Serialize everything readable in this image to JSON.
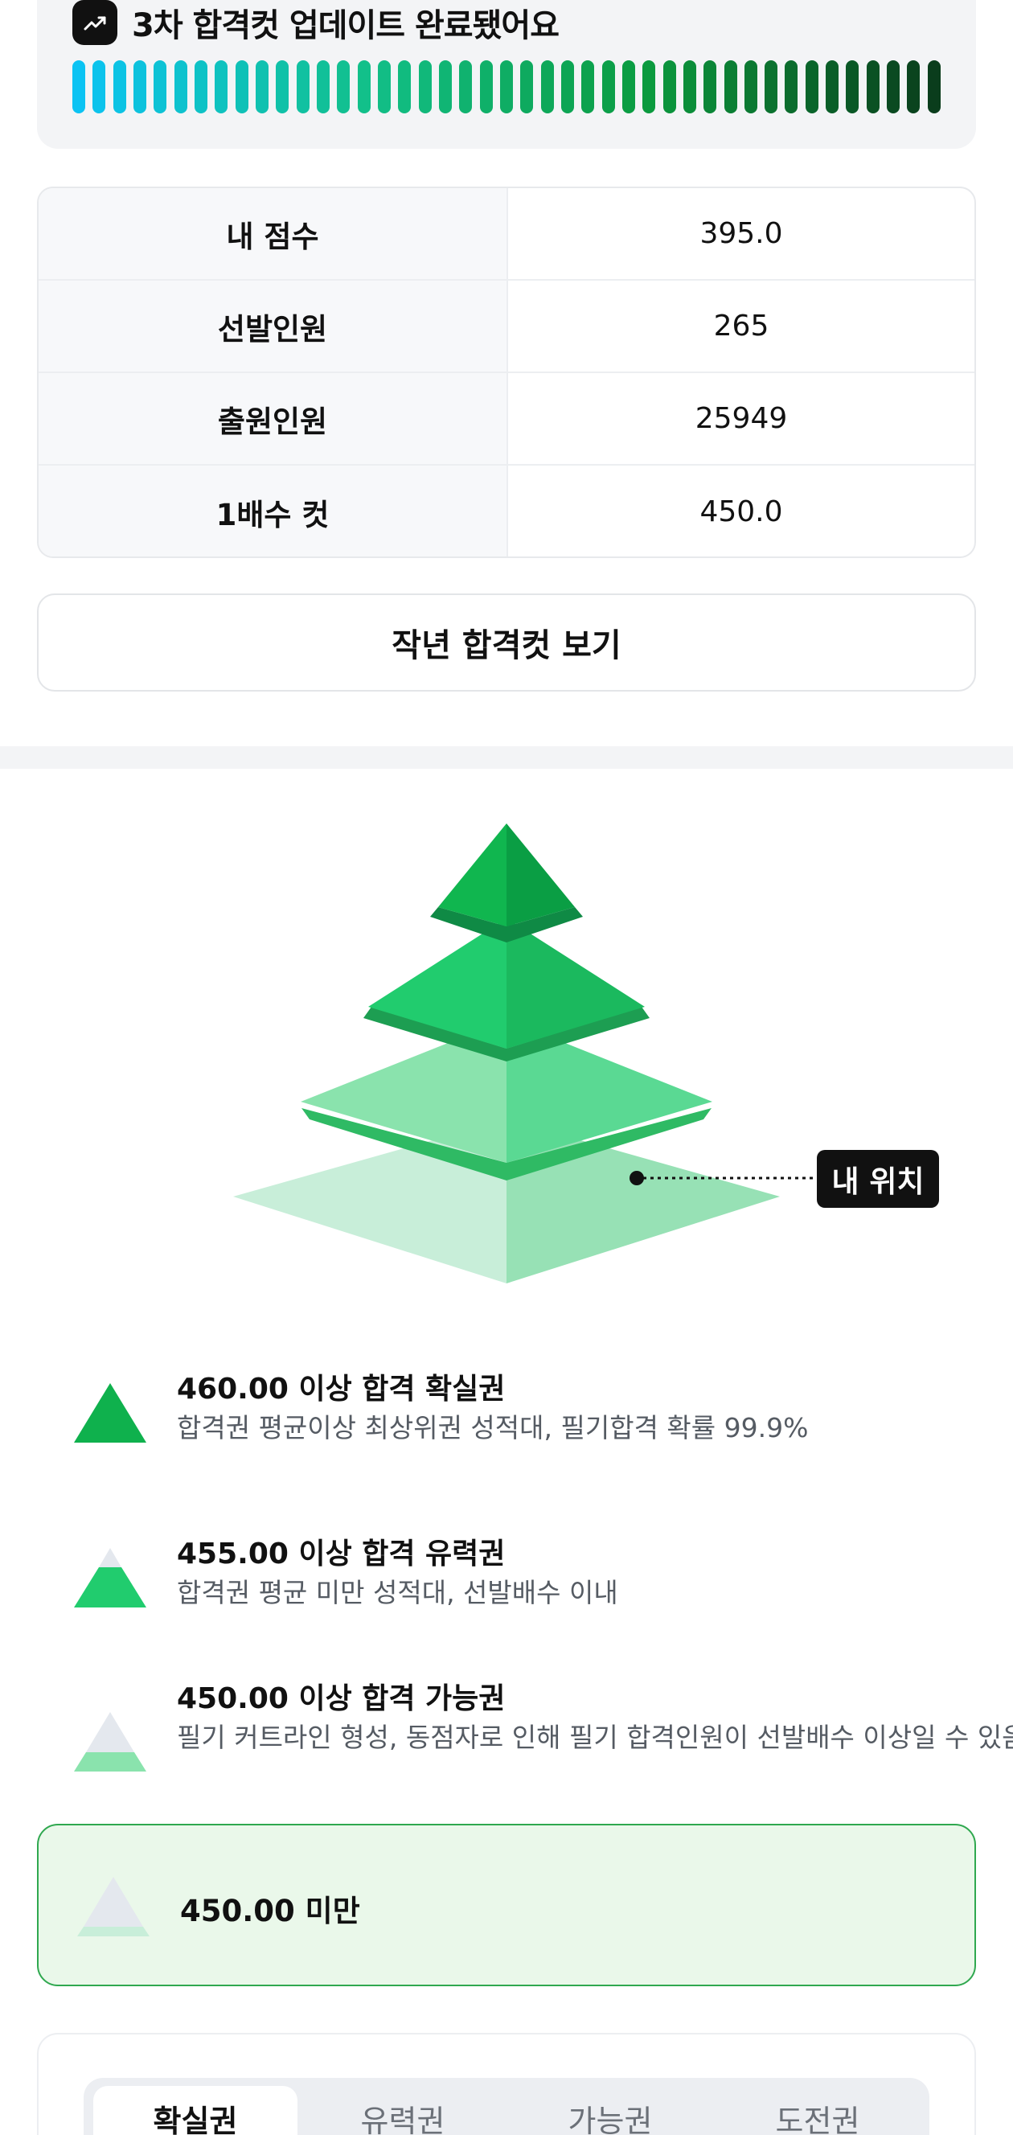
{
  "update_banner": {
    "icon": "trend-up-icon",
    "title": "3차 합격컷 업데이트 완료됐어요",
    "bar_count": 43,
    "gradient_colors": [
      "#0bc3f3",
      "#12c08a",
      "#0b9a3e",
      "#0a3d1c"
    ]
  },
  "stats": [
    {
      "label": "내 점수",
      "value": "395.0"
    },
    {
      "label": "선발인원",
      "value": "265"
    },
    {
      "label": "출원인원",
      "value": "25949"
    },
    {
      "label": "1배수 컷",
      "value": "450.0"
    }
  ],
  "last_year_button": "작년 합격컷 보기",
  "pyramid": {
    "my_position_label": "내 위치",
    "tier_colors": [
      "#0fb14d",
      "#21cc6e",
      "#8ae3ad",
      "#c8eed9"
    ]
  },
  "legend": [
    {
      "title": "460.00 이상 합격 확실권",
      "desc": "합격권 평균이상 최상위권 성적대, 필기합격 확률 99.9%",
      "icon": "pyramid-tier-1-icon"
    },
    {
      "title": "455.00 이상 합격 유력권",
      "desc": "합격권 평균 미만 성적대, 선발배수 이내",
      "icon": "pyramid-tier-2-icon"
    },
    {
      "title": "450.00 이상 합격 가능권",
      "desc": "필기 커트라인 형성, 동점자로 인해 필기 합격인원이 선발배수 이상일 수 있음",
      "icon": "pyramid-tier-3-icon"
    }
  ],
  "below_cut": {
    "title": "450.00 미만",
    "icon": "pyramid-tier-4-icon"
  },
  "tabs": [
    {
      "label": "확실권",
      "active": true
    },
    {
      "label": "유력권",
      "active": false
    },
    {
      "label": "가능권",
      "active": false
    },
    {
      "label": "도전권",
      "active": false
    }
  ],
  "colors": {
    "accent_green": "#2fa84f",
    "highlight_bg": "#eaf8ea"
  }
}
